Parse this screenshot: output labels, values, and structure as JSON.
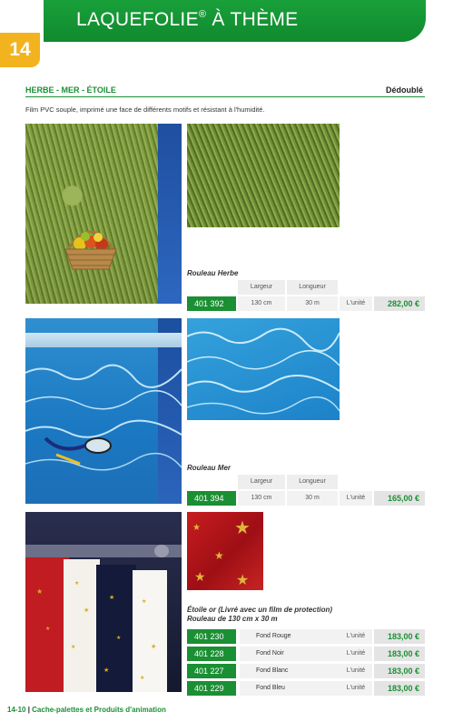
{
  "header": {
    "title": "LAQUEFOLIE",
    "trademark": "®",
    "title_suffix": " À THÈME",
    "page_number": "14"
  },
  "section": {
    "title": "HERBE - MER - ÉTOILE",
    "variant": "Dédoublé",
    "description": "Film PVC souple, imprimé une face de différents motifs et résistant à l'humidité."
  },
  "spec_headers": {
    "width": "Largeur",
    "length": "Longueur"
  },
  "products": {
    "herbe": {
      "name": "Rouleau Herbe",
      "ref": "401 392",
      "width": "130 cm",
      "length": "30  m",
      "unit": "L'unité",
      "price": "282,00 €"
    },
    "mer": {
      "name": "Rouleau Mer",
      "ref": "401 394",
      "width": "130 cm",
      "length": "30  m",
      "unit": "L'unité",
      "price": "165,00 €"
    },
    "etoile": {
      "name_line1": "Étoile or (Livré avec un film de protection)",
      "name_line2": "Rouleau de  130 cm x 30  m",
      "variants": [
        {
          "ref": "401 230",
          "label": "Fond Rouge",
          "unit": "L'unité",
          "price": "183,00 €",
          "icon": "star-red-icon",
          "color": "#c8161d"
        },
        {
          "ref": "401 228",
          "label": "Fond Noir",
          "unit": "L'unité",
          "price": "183,00 €",
          "icon": "star-black-icon",
          "color": "#111111"
        },
        {
          "ref": "401 227",
          "label": "Fond Blanc",
          "unit": "L'unité",
          "price": "183,00 €",
          "icon": "star-white-icon",
          "color": "#ffffff"
        },
        {
          "ref": "401 229",
          "label": "Fond Bleu",
          "unit": "L'unité",
          "price": "183,00 €",
          "icon": "star-blue-icon",
          "color": "#1b58a8"
        }
      ]
    }
  },
  "footer": {
    "page_ref": "14-10",
    "separator": " | ",
    "text": "Cache-palettes et Produits d'animation"
  },
  "colors": {
    "brand_green": "#1b8f33",
    "badge_yellow": "#f2b31f",
    "star_gold": "#f1c21b"
  }
}
